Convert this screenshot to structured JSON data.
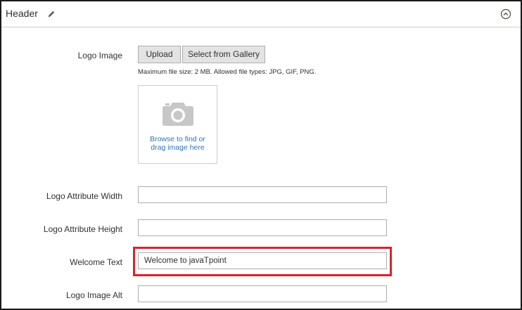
{
  "section": {
    "title": "Header"
  },
  "logo_image": {
    "label": "Logo Image",
    "upload_label": "Upload",
    "gallery_label": "Select from Gallery",
    "note": "Maximum file size: 2 MB. Allowed file types: JPG, GIF, PNG.",
    "dropzone_line1": "Browse to find or",
    "dropzone_line2": "drag image here"
  },
  "fields": {
    "logo_width": {
      "label": "Logo Attribute Width",
      "value": ""
    },
    "logo_height": {
      "label": "Logo Attribute Height",
      "value": ""
    },
    "welcome_text": {
      "label": "Welcome Text",
      "value": "Welcome to javaTpoint"
    },
    "logo_alt": {
      "label": "Logo Image Alt",
      "value": ""
    }
  },
  "colors": {
    "highlight": "#d9232d",
    "link": "#2e74b5",
    "button_bg": "#e3e3e3"
  }
}
